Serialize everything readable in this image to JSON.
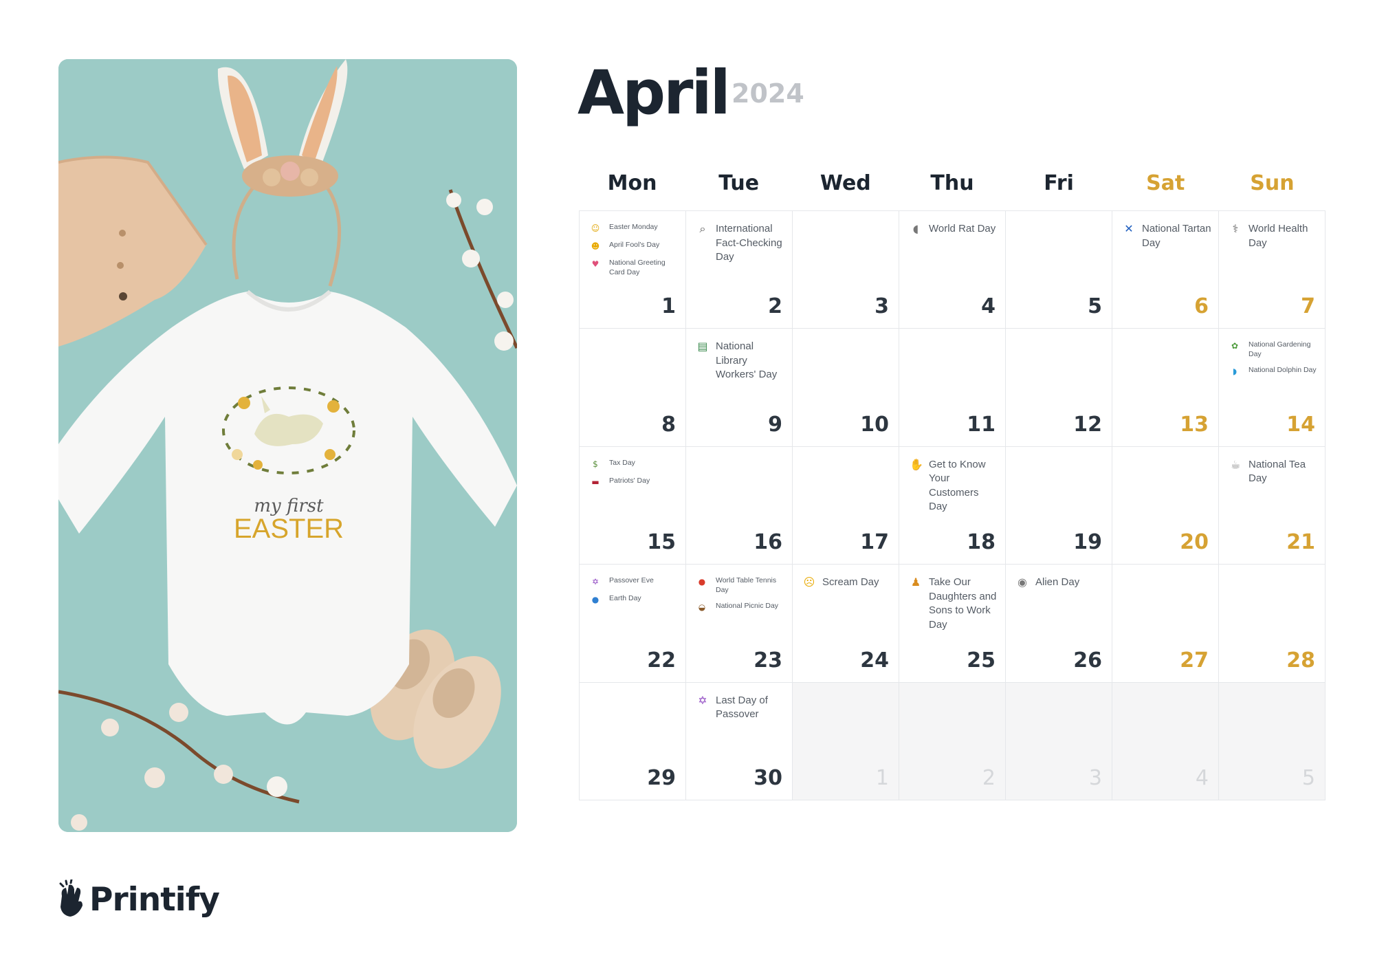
{
  "month": "April",
  "year": "2024",
  "brand": "Printify",
  "design_text": {
    "line1": "my first",
    "line2": "EASTER"
  },
  "colors": {
    "accent_weekend": "#d6a233",
    "dark": "#1c2530",
    "photo_bg": "#9ccbc6"
  },
  "weekdays": [
    {
      "label": "Mon",
      "weekend": false
    },
    {
      "label": "Tue",
      "weekend": false
    },
    {
      "label": "Wed",
      "weekend": false
    },
    {
      "label": "Thu",
      "weekend": false
    },
    {
      "label": "Fri",
      "weekend": false
    },
    {
      "label": "Sat",
      "weekend": true
    },
    {
      "label": "Sun",
      "weekend": true
    }
  ],
  "days": [
    {
      "num": "1",
      "small": true,
      "events": [
        {
          "icon": "sun-face-icon",
          "glyph": "☺",
          "color": "#e0a400",
          "text": "Easter Monday"
        },
        {
          "icon": "winking-face-icon",
          "glyph": "☻",
          "color": "#e8a900",
          "text": "April Fool's Day"
        },
        {
          "icon": "greeting-card-icon",
          "glyph": "♥",
          "color": "#e0507a",
          "text": "National Greeting Card Day"
        }
      ]
    },
    {
      "num": "2",
      "events": [
        {
          "icon": "magnifier-icon",
          "glyph": "⌕",
          "color": "#555",
          "text": "International Fact-Checking Day"
        }
      ]
    },
    {
      "num": "3",
      "events": []
    },
    {
      "num": "4",
      "events": [
        {
          "icon": "rat-icon",
          "glyph": "◖",
          "color": "#777",
          "text": "World Rat Day"
        }
      ]
    },
    {
      "num": "5",
      "events": []
    },
    {
      "num": "6",
      "weekend": true,
      "events": [
        {
          "icon": "scotland-flag-icon",
          "glyph": "✕",
          "color": "#1f5fbf",
          "text": "National Tartan Day"
        }
      ]
    },
    {
      "num": "7",
      "weekend": true,
      "events": [
        {
          "icon": "stethoscope-icon",
          "glyph": "⚕",
          "color": "#666",
          "text": "World Health Day"
        }
      ]
    },
    {
      "num": "8",
      "events": []
    },
    {
      "num": "9",
      "events": [
        {
          "icon": "books-icon",
          "glyph": "▤",
          "color": "#3b8a4e",
          "text": "National Library Workers' Day"
        }
      ]
    },
    {
      "num": "10",
      "events": []
    },
    {
      "num": "11",
      "events": []
    },
    {
      "num": "12",
      "events": []
    },
    {
      "num": "13",
      "weekend": true,
      "events": []
    },
    {
      "num": "14",
      "weekend": true,
      "small": true,
      "events": [
        {
          "icon": "potted-plant-icon",
          "glyph": "✿",
          "color": "#4c9a3a",
          "text": "National Gardening Day"
        },
        {
          "icon": "dolphin-icon",
          "glyph": "◗",
          "color": "#2a9bd8",
          "text": "National Dolphin Day"
        }
      ]
    },
    {
      "num": "15",
      "small": true,
      "events": [
        {
          "icon": "money-icon",
          "glyph": "$",
          "color": "#5a8f3c",
          "text": "Tax Day"
        },
        {
          "icon": "us-flag-icon",
          "glyph": "▬",
          "color": "#b22234",
          "text": "Patriots' Day"
        }
      ]
    },
    {
      "num": "16",
      "events": []
    },
    {
      "num": "17",
      "events": []
    },
    {
      "num": "18",
      "events": [
        {
          "icon": "waving-hand-icon",
          "glyph": "✋",
          "color": "#e8a900",
          "text": "Get to Know Your Customers Day"
        }
      ]
    },
    {
      "num": "19",
      "events": []
    },
    {
      "num": "20",
      "weekend": true,
      "events": []
    },
    {
      "num": "21",
      "weekend": true,
      "events": [
        {
          "icon": "teapot-icon",
          "glyph": "☕",
          "color": "#888",
          "text": "National Tea Day"
        }
      ]
    },
    {
      "num": "22",
      "small": true,
      "events": [
        {
          "icon": "star-of-david-icon",
          "glyph": "✡",
          "color": "#8a3fbf",
          "text": "Passover Eve"
        },
        {
          "icon": "globe-icon",
          "glyph": "●",
          "color": "#2f7fd1",
          "text": "Earth Day"
        }
      ]
    },
    {
      "num": "23",
      "small": true,
      "events": [
        {
          "icon": "ping-pong-icon",
          "glyph": "●",
          "color": "#d93b2b",
          "text": "World Table Tennis Day"
        },
        {
          "icon": "picnic-basket-icon",
          "glyph": "◒",
          "color": "#8a5a2b",
          "text": "National Picnic Day"
        }
      ]
    },
    {
      "num": "24",
      "events": [
        {
          "icon": "screaming-face-icon",
          "glyph": "☹",
          "color": "#e8a900",
          "text": "Scream Day"
        }
      ]
    },
    {
      "num": "25",
      "events": [
        {
          "icon": "worker-icon",
          "glyph": "♟",
          "color": "#d98c1f",
          "text": "Take Our Daughters and Sons to Work Day"
        }
      ]
    },
    {
      "num": "26",
      "events": [
        {
          "icon": "alien-icon",
          "glyph": "◉",
          "color": "#777",
          "text": "Alien Day"
        }
      ]
    },
    {
      "num": "27",
      "weekend": true,
      "events": []
    },
    {
      "num": "28",
      "weekend": true,
      "events": []
    },
    {
      "num": "29",
      "events": []
    },
    {
      "num": "30",
      "events": [
        {
          "icon": "star-of-david-icon",
          "glyph": "✡",
          "color": "#8a3fbf",
          "text": "Last Day of Passover"
        }
      ]
    },
    {
      "num": "1",
      "other": true,
      "events": []
    },
    {
      "num": "2",
      "other": true,
      "events": []
    },
    {
      "num": "3",
      "other": true,
      "events": []
    },
    {
      "num": "4",
      "other": true,
      "events": []
    },
    {
      "num": "5",
      "other": true,
      "events": []
    }
  ]
}
